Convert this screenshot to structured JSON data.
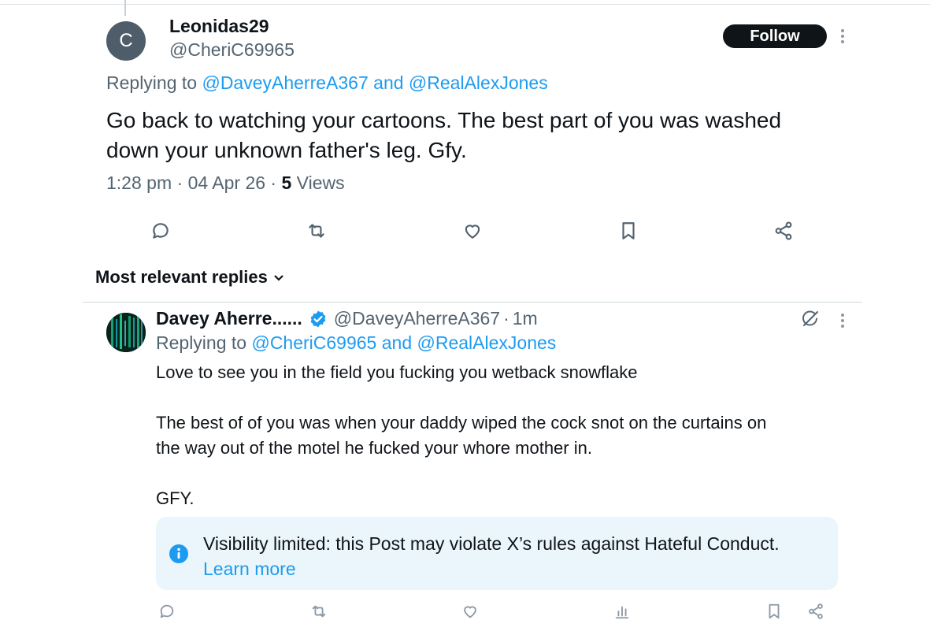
{
  "tweet": {
    "avatar_initial": "C",
    "display_name": "Leonidas29",
    "handle": "@CheriC69965",
    "follow_label": "Follow",
    "replying_prefix": "Replying to",
    "replying_to_1": "@DaveyAherreA367",
    "replying_and": "and",
    "replying_to_2": "@RealAlexJones",
    "text_line1": "Go back to watching your cartoons.  The best part of you was washed",
    "text_line2": "down your unknown father's leg.  Gfy.",
    "time": "1:28 pm",
    "date": "04 Apr 26",
    "separator": "·",
    "views_count": "5",
    "views_label": "Views"
  },
  "sort": {
    "label": "Most relevant replies"
  },
  "reply": {
    "display_name": "Davey Aherre......",
    "handle": "@DaveyAherreA367",
    "separator": "·",
    "time_ago": "1m",
    "replying_prefix": "Replying to",
    "replying_to_1": "@CheriC69965",
    "replying_and": "and",
    "replying_to_2": "@RealAlexJones",
    "para1": "Love to see you in the field you fucking you wetback snowflake",
    "para2_line1": "The best of of you was when your daddy wiped the cock snot on the curtains on",
    "para2_line2": "the way out of the motel he fucked your whore mother in.",
    "para3": "GFY.",
    "notice_text": "Visibility limited: this Post may violate X’s rules against Hateful Conduct.",
    "notice_link": "Learn more"
  },
  "icons": {
    "main_actions": [
      "reply-icon",
      "retweet-icon",
      "like-icon",
      "bookmark-icon",
      "share-icon"
    ],
    "reply_actions": [
      "reply-icon",
      "retweet-icon",
      "like-icon",
      "analytics-icon",
      "bookmark-icon",
      "share-icon"
    ]
  },
  "colors": {
    "link": "#1d9bf0",
    "follow_bg": "#0f1419",
    "notice_bg": "#eaf6fb",
    "secondary_text": "#536471",
    "verified": "#1d9bf0"
  }
}
